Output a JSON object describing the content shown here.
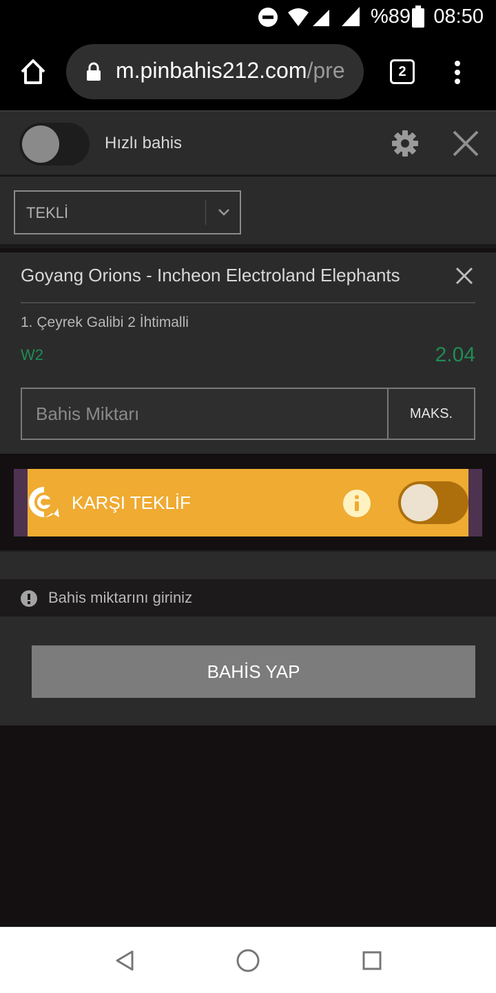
{
  "status_bar": {
    "battery": "%89",
    "time": "08:50"
  },
  "browser": {
    "url_host": "m.pinbahis212.com",
    "url_path": "/pre",
    "tab_count": "2"
  },
  "quick_bet": {
    "label": "Hızlı bahis",
    "enabled": false
  },
  "bet_type": {
    "selected": "TEKLİ"
  },
  "bet": {
    "match": "Goyang Orions - Incheon Electroland Elephants",
    "market": "1. Çeyrek Galibi 2 İhtimalli",
    "outcome": "W2",
    "odds": "2.04",
    "stake_placeholder": "Bahis Miktarı",
    "max_label": "MAKS."
  },
  "counter_offer": {
    "label": "KARŞI TEKLİF",
    "enabled": false
  },
  "warning": {
    "text": "Bahis miktarını giriniz"
  },
  "place_bet": {
    "label": "BAHİS YAP"
  },
  "colors": {
    "accent_green": "#1f8c55",
    "offer_orange": "#efab32",
    "offer_purple": "#4d3350"
  }
}
